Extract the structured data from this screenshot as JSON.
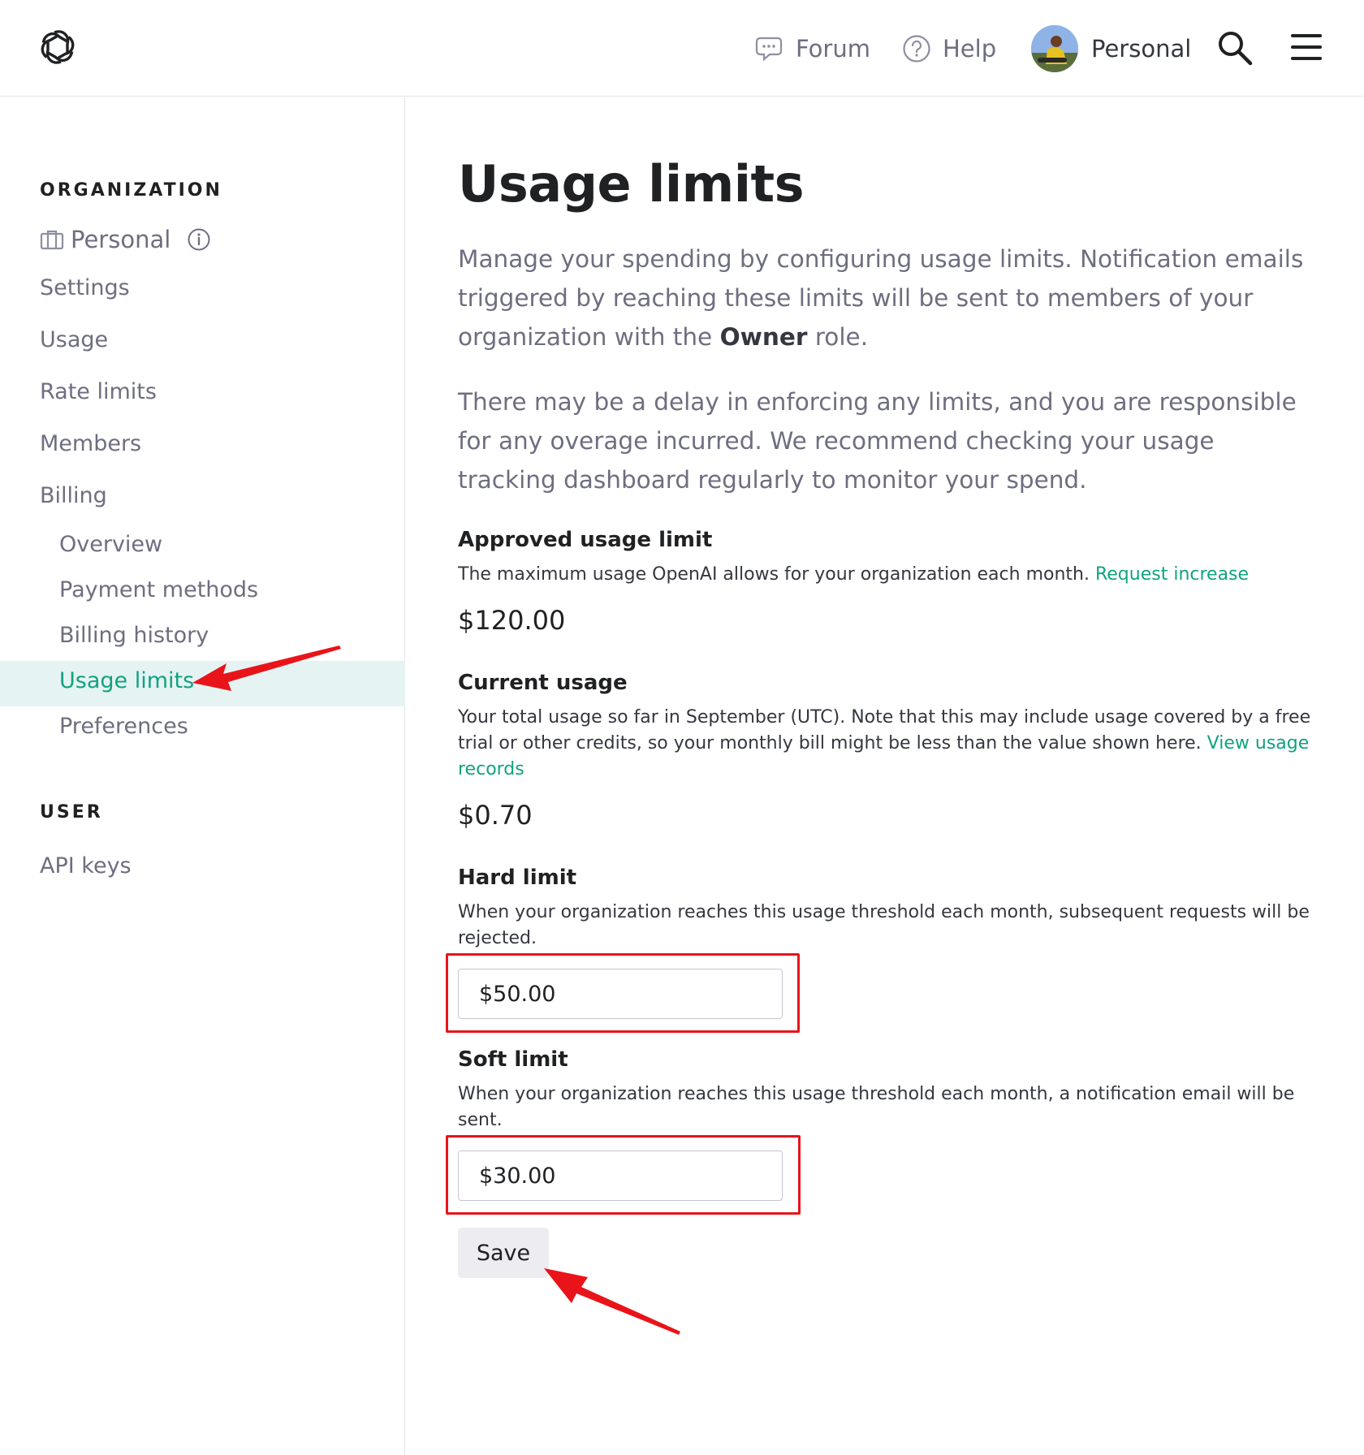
{
  "header": {
    "forum_label": "Forum",
    "help_label": "Help",
    "profile_label": "Personal"
  },
  "sidebar": {
    "org_section": "ORGANIZATION",
    "org_name": "Personal",
    "items": [
      {
        "label": "Settings"
      },
      {
        "label": "Usage"
      },
      {
        "label": "Rate limits"
      },
      {
        "label": "Members"
      },
      {
        "label": "Billing"
      }
    ],
    "billing_sub": [
      {
        "label": "Overview"
      },
      {
        "label": "Payment methods"
      },
      {
        "label": "Billing history"
      },
      {
        "label": "Usage limits",
        "active": true
      },
      {
        "label": "Preferences"
      }
    ],
    "user_section": "USER",
    "user_items": [
      {
        "label": "API keys"
      }
    ]
  },
  "main": {
    "title": "Usage limits",
    "intro1_a": "Manage your spending by configuring usage limits. Notification emails triggered by reaching these limits will be sent to members of your organization with the ",
    "intro1_bold": "Owner",
    "intro1_b": " role.",
    "intro2": "There may be a delay in enforcing any limits, and you are responsible for any overage incurred. We recommend checking your usage tracking dashboard regularly to monitor your spend.",
    "approved": {
      "heading": "Approved usage limit",
      "desc": "The maximum usage OpenAI allows for your organization each month. ",
      "link": "Request increase",
      "value": "$120.00"
    },
    "current": {
      "heading": "Current usage",
      "desc": "Your total usage so far in September (UTC). Note that this may include usage covered by a free trial or other credits, so your monthly bill might be less than the value shown here. ",
      "link": "View usage records",
      "value": "$0.70"
    },
    "hard": {
      "heading": "Hard limit",
      "desc": "When your organization reaches this usage threshold each month, subsequent requests will be rejected.",
      "value": "$50.00"
    },
    "soft": {
      "heading": "Soft limit",
      "desc": "When your organization reaches this usage threshold each month, a notification email will be sent.",
      "value": "$30.00"
    },
    "save_label": "Save"
  },
  "colors": {
    "accent": "#10a37f",
    "annotation": "#e8141a",
    "active_bg": "#e6f3f3"
  }
}
